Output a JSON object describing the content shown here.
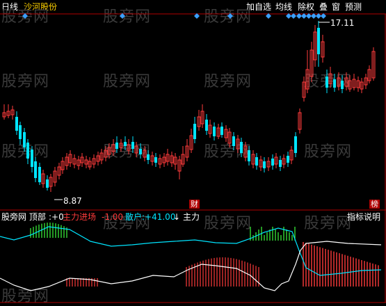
{
  "header": {
    "period": "日线",
    "stock": "沙河股份",
    "buttons": [
      "加自选",
      "均线",
      "除权",
      "叠",
      "窗",
      "预测"
    ]
  },
  "main_chart": {
    "high_label": "17.11",
    "low_label": "8.87",
    "fin_tag": "财",
    "bang_tag": "榜"
  },
  "indicator": {
    "name": "股旁网 顶部",
    "top_value": ":+0",
    "main_in_label": "主力进场",
    "main_in_value": "-1.00",
    "retail_label": "散户",
    "retail_value": ":+41.00",
    "arrow": "↓",
    "main_label": "主力",
    "help_button": "指标说明"
  },
  "watermark": "股旁网",
  "colors": {
    "up": "#ff3b3b",
    "down": "#00e5ff",
    "diamond": "#3aa0ff",
    "green": "#3cff3c",
    "white": "#ffffff",
    "panel_line": "#b00000"
  }
}
